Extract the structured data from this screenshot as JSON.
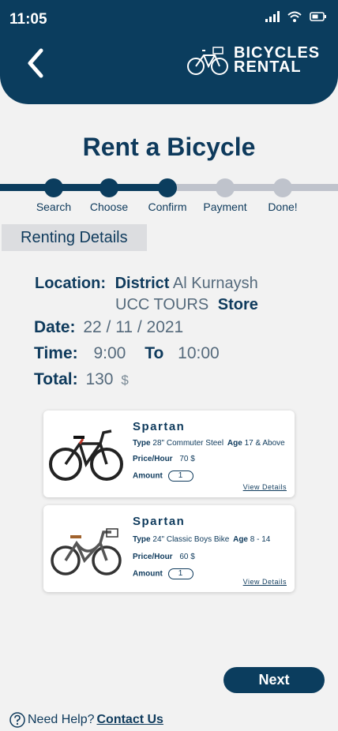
{
  "status_bar": {
    "time": "11:05"
  },
  "header": {
    "logo_line1": "BICYCLES",
    "logo_line2": "RENTAL"
  },
  "page": {
    "title": "Rent a Bicycle"
  },
  "stepper": {
    "steps": [
      {
        "label": "Search",
        "state": "done"
      },
      {
        "label": "Choose",
        "state": "done"
      },
      {
        "label": "Confirm",
        "state": "done"
      },
      {
        "label": "Payment",
        "state": "todo"
      },
      {
        "label": "Done!",
        "state": "todo"
      }
    ]
  },
  "details": {
    "section_title": "Renting Details",
    "location_label": "Location:",
    "location_district_label": "District",
    "location_district_value": "Al Kurnaysh",
    "location_store_value": "UCC TOURS",
    "location_store_label": "Store",
    "date_label": "Date:",
    "date_value": "22 / 11 / 2021",
    "time_label": "Time:",
    "time_from": "9:00",
    "time_to_label": "To",
    "time_to": "10:00",
    "total_label": "Total:",
    "total_value": "130",
    "currency": "$"
  },
  "bikes": [
    {
      "name": "Spartan",
      "type_label": "Type",
      "type_value": "28\" Commuter Steel",
      "age_label": "Age",
      "age_value": "17 & Above",
      "price_label": "Price/Hour",
      "price_value": "70",
      "currency": "$",
      "amount_label": "Amount",
      "amount_value": "1",
      "view_details": "View Details"
    },
    {
      "name": "Spartan",
      "type_label": "Type",
      "type_value": "24\" Classic Boys Bike",
      "age_label": "Age",
      "age_value": "8 - 14",
      "price_label": "Price/Hour",
      "price_value": "60",
      "currency": "$",
      "amount_label": "Amount",
      "amount_value": "1",
      "view_details": "View Details"
    }
  ],
  "actions": {
    "next_label": "Next"
  },
  "help": {
    "text": "Need Help?",
    "link": "Contact Us"
  },
  "colors": {
    "primary": "#0b3d5e",
    "inactive": "#bfc3cc",
    "background": "#f2f2f2"
  }
}
